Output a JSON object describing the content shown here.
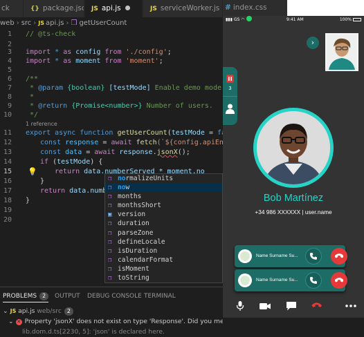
{
  "editor": {
    "tabs": [
      {
        "label": "ck"
      },
      {
        "label": "package.json",
        "icon": "{}"
      },
      {
        "label": "api.js",
        "icon": "JS",
        "modified": true
      },
      {
        "label": "serviceWorker.js",
        "icon": "JS"
      }
    ],
    "breadcrumb": {
      "p1": "web",
      "p2": "src",
      "file": "api.js",
      "symbol": "getUserCount"
    },
    "codelens": "1 reference",
    "lines": [
      {
        "n": "1"
      },
      {
        "n": "2"
      },
      {
        "n": "3"
      },
      {
        "n": "4"
      },
      {
        "n": "5"
      },
      {
        "n": "6"
      },
      {
        "n": "7"
      },
      {
        "n": "8"
      },
      {
        "n": "9"
      },
      {
        "n": "10"
      },
      {
        "n": "11"
      },
      {
        "n": "12"
      },
      {
        "n": "13"
      },
      {
        "n": "14"
      },
      {
        "n": "15"
      },
      {
        "n": "16"
      },
      {
        "n": "17"
      },
      {
        "n": "18"
      },
      {
        "n": "19"
      },
      {
        "n": "20"
      }
    ],
    "code": {
      "l1": "// @ts-check",
      "l3": {
        "kw1": "import",
        "rest1": " * ",
        "kw2": "as",
        "name": " config ",
        "kw3": "from",
        "str": " './config'",
        "end": ";"
      },
      "l4": {
        "kw1": "import",
        "rest1": " * ",
        "kw2": "as",
        "name": " moment ",
        "kw3": "from",
        "str": " 'moment'",
        "end": ";"
      },
      "l6": "/**",
      "l7": {
        "pre": " * ",
        "tag": "@param",
        "type": " {boolean} ",
        "name": "[testMode]",
        "desc": " Enable demo mode."
      },
      "l8": " *",
      "l9": {
        "pre": " * ",
        "tag": "@return",
        "type": " {Promise<number>}",
        "desc": " Number of users."
      },
      "l10": " */",
      "l11": {
        "kw1": "export",
        "kw2": " async",
        "kw3": " function",
        "fn": " getUserCount",
        "p1": "(",
        "param": "testMode",
        "p2": " = ",
        "val": "false",
        "p3": ") {"
      },
      "l12": {
        "kw": "const",
        "v": " response",
        "eq": " = ",
        "aw": "await",
        "fn": " fetch",
        "rest": "(`${config.apiEndpoint"
      },
      "l13": {
        "kw": "const",
        "v": " data",
        "eq": " = ",
        "aw": "await",
        "obj": " response",
        "dot": ".",
        "err": "jsonX",
        "rest": "();"
      },
      "l14": {
        "kw": "if",
        "rest": " (",
        "v": "testMode",
        "end": ") {"
      },
      "l15": {
        "kw": "return",
        "rest": " data.numberServed * moment.no"
      },
      "l16": "}",
      "l17": {
        "kw": "return",
        "rest": " data.number"
      },
      "l18": "}"
    },
    "suggestions": [
      {
        "m": "no",
        "r": "rmalizeUnits"
      },
      {
        "m": "no",
        "r": "w",
        "selected": true
      },
      {
        "m": "",
        "r": "months"
      },
      {
        "m": "",
        "r": "monthsShort"
      },
      {
        "m": "",
        "r": "version"
      },
      {
        "m": "",
        "r": "duration"
      },
      {
        "m": "",
        "r": "parseZone"
      },
      {
        "m": "",
        "r": "defineLocale"
      },
      {
        "m": "",
        "r": "isDuration"
      },
      {
        "m": "",
        "r": "calendarFormat"
      },
      {
        "m": "",
        "r": "isMoment"
      },
      {
        "m": "",
        "r": "toString"
      }
    ],
    "panel": {
      "tabs": {
        "problems": "PROBLEMS",
        "problems_count": "2",
        "output": "OUTPUT",
        "debug": "DEBUG CONSOLE",
        "terminal": "TERMINAL"
      },
      "file": "api.js",
      "path": "web/src",
      "file_count": "2",
      "error": "Property 'jsonX' does not exist on type 'Response'. Did you mean 'json'? ts(2551) [13, 35]",
      "related": "lib.dom.d.ts[2230, 5]: 'json' is declared here."
    }
  },
  "right_tab": {
    "label": "index.css"
  },
  "phone": {
    "status": {
      "carrier": "GS",
      "time": "9:41 AM",
      "battery": "100%"
    },
    "queue_count": "3",
    "contact_name": "Bob Martínez",
    "contact_info": "+34 986 XXXXXX | user.name",
    "calls": [
      {
        "name": "Name Surname Su..."
      },
      {
        "name": "Name Surname Su..."
      }
    ],
    "colors": {
      "accent": "#26d3c7",
      "panel": "#1d6c66",
      "decline": "#e63a3a",
      "background": "#333333"
    }
  }
}
